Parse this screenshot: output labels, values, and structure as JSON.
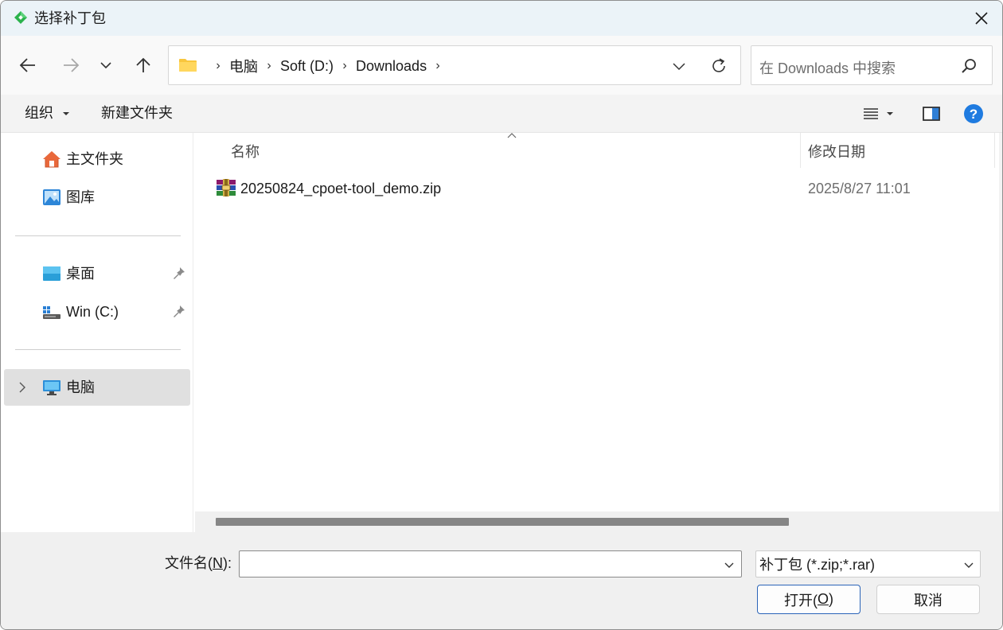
{
  "window": {
    "title": "选择补丁包",
    "close_icon": "close-icon"
  },
  "nav": {
    "back_icon": "arrow-left-icon",
    "forward_icon": "arrow-right-icon",
    "recent_icon": "chevron-down-icon",
    "up_icon": "arrow-up-icon"
  },
  "address": {
    "crumbs": [
      "电脑",
      "Soft (D:)",
      "Downloads"
    ],
    "separator": "›"
  },
  "search": {
    "placeholder": "在 Downloads 中搜索"
  },
  "toolbar": {
    "organize_label": "组织",
    "new_folder_label": "新建文件夹"
  },
  "sidebar": {
    "quick": [
      {
        "label": "主文件夹",
        "icon": "home-icon"
      },
      {
        "label": "图库",
        "icon": "gallery-icon"
      }
    ],
    "pinned": [
      {
        "label": "桌面",
        "icon": "desktop-icon"
      },
      {
        "label": "Win (C:)",
        "icon": "drive-icon"
      }
    ],
    "tree": [
      {
        "label": "电脑",
        "icon": "computer-icon",
        "selected": true
      }
    ]
  },
  "columns": {
    "name": "名称",
    "date": "修改日期"
  },
  "files": [
    {
      "name": "20250824_cpoet-tool_demo.zip",
      "date": "2025/8/27 11:01",
      "icon": "winrar-archive-icon"
    }
  ],
  "bottom": {
    "filename_label_pre": "文件名(",
    "filename_label_key": "N",
    "filename_label_post": "):",
    "filename_value": "",
    "file_type": "补丁包 (*.zip;*.rar)",
    "open_pre": "打开(",
    "open_key": "O",
    "open_post": ")",
    "cancel_label": "取消"
  }
}
